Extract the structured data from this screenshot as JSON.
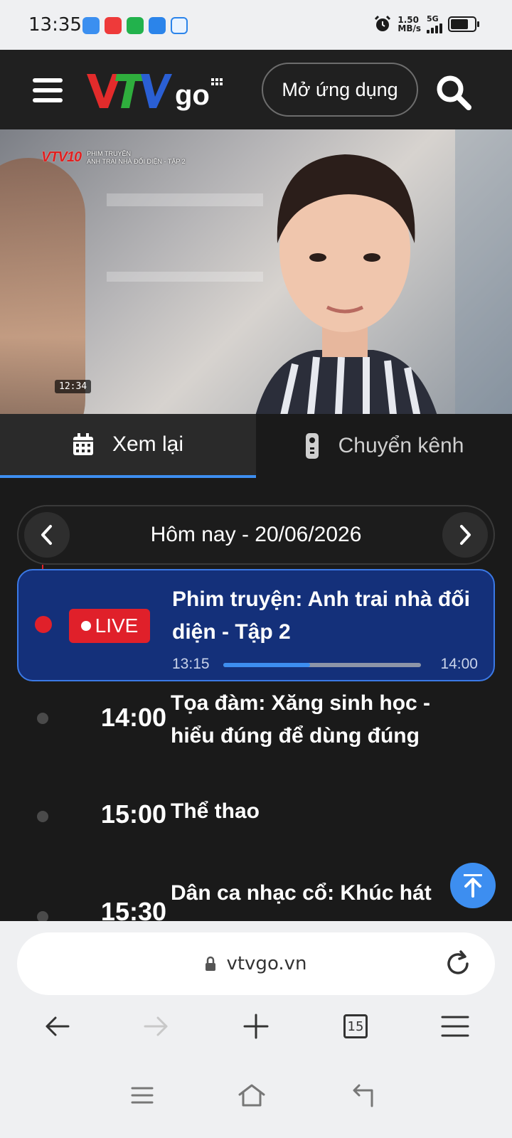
{
  "status_bar": {
    "time": "13:35",
    "speed_value": "1.50",
    "speed_unit": "MB/s",
    "network": "5G",
    "app_icon_colors": [
      "#3b8ff0",
      "#ee3a3a",
      "#22b24c",
      "#2b84ea",
      "#e9f3ff"
    ]
  },
  "header": {
    "logo_text": "VTV",
    "logo_suffix": "go",
    "logo_colors": [
      "#e22b2b",
      "#2fae3d",
      "#2a5fd4"
    ],
    "open_app_label": "Mở ứng dụng"
  },
  "video": {
    "channel_logo": "VTV10",
    "channel_line1": "PHIM TRUYỆN",
    "channel_line2": "ANH TRAI NHÀ ĐỐI DIỆN - TẬP 2",
    "clock": "12:34"
  },
  "tabs": [
    {
      "label": "Xem lại",
      "icon": "calendar-icon",
      "active": true
    },
    {
      "label": "Chuyển kênh",
      "icon": "remote-icon",
      "active": false
    }
  ],
  "date_selector": {
    "label": "Hôm nay - 20/06/2026"
  },
  "schedule": {
    "live": {
      "badge": "LIVE",
      "title": "Phim truyện: Anh trai nhà đối diện - Tập 2",
      "start": "13:15",
      "end": "14:00",
      "progress": 0.44
    },
    "items": [
      {
        "time": "14:00",
        "title": "Tọa đàm: Xăng sinh học - hiểu đúng để dùng đúng"
      },
      {
        "time": "15:00",
        "title": "Thể thao"
      },
      {
        "time": "15:30",
        "title": "Dân ca nhạc cổ: Khúc hát"
      }
    ]
  },
  "browser": {
    "url": "vtvgo.vn",
    "tab_count": "15"
  },
  "colors": {
    "accent": "#3d8ef0",
    "live_red": "#e0202a",
    "live_card": "#14307a"
  }
}
